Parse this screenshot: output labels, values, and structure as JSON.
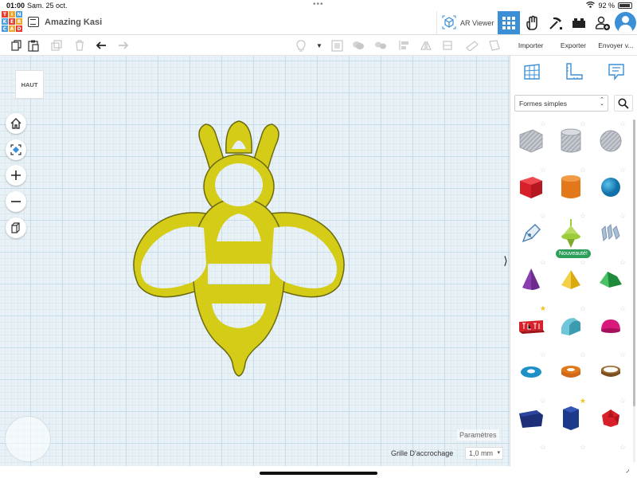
{
  "status_bar": {
    "time": "01:00",
    "date": "Sam. 25 oct.",
    "battery": "92 %"
  },
  "app": {
    "logo_letters": [
      "T",
      "I",
      "N",
      "K",
      "E",
      "R",
      "C",
      "A",
      "D"
    ],
    "design_title": "Amazing Kasi",
    "ar_viewer_label": "AR Viewer",
    "accent_color": "#3a8fd6"
  },
  "toolbar": {
    "icons": [
      "copy-icon",
      "paste-icon",
      "duplicate-icon",
      "delete-icon",
      "undo-icon",
      "redo-icon",
      "light-icon",
      "dropdown-icon",
      "hole-icon",
      "group-icon",
      "align-icon",
      "mirror-icon",
      "ruler-icon",
      "workplane-icon",
      "note-icon"
    ]
  },
  "panel_tabs": {
    "import": "Importer",
    "export": "Exporter",
    "send": "Envoyer v..."
  },
  "viewport": {
    "view_cube_label": "HAUT",
    "model_color": "#d4cc16",
    "params_label": "Paramètres",
    "snap_label": "Grille D'accrochage",
    "snap_value": "1,0 mm"
  },
  "library": {
    "category": "Formes simples",
    "new_badge": "Nouveauté!",
    "shapes": [
      {
        "name": "box-hole",
        "color": "#b8bcc4"
      },
      {
        "name": "cylinder-hole",
        "color": "#b8bcc4"
      },
      {
        "name": "sphere-hole",
        "color": "#b8bcc4"
      },
      {
        "name": "box",
        "color": "#d8202a"
      },
      {
        "name": "cylinder",
        "color": "#e2781a"
      },
      {
        "name": "sphere",
        "color": "#1e90c8"
      },
      {
        "name": "scribble",
        "color": "#4a7fb5"
      },
      {
        "name": "shape-generator",
        "color": "#9ccc3c"
      },
      {
        "name": "text-3d",
        "color": "#9ab0c8"
      },
      {
        "name": "cone",
        "color": "#8a3fb0"
      },
      {
        "name": "pyramid",
        "color": "#f0c419"
      },
      {
        "name": "roof",
        "color": "#2ea94b"
      },
      {
        "name": "text",
        "color": "#d8202a"
      },
      {
        "name": "round-roof",
        "color": "#5ab8c8"
      },
      {
        "name": "half-sphere",
        "color": "#d8187a"
      },
      {
        "name": "torus",
        "color": "#1e90c8"
      },
      {
        "name": "tube",
        "color": "#e2781a"
      },
      {
        "name": "ring",
        "color": "#9c6a30"
      },
      {
        "name": "wedge",
        "color": "#1c2f78"
      },
      {
        "name": "polygon",
        "color": "#1c3a8a"
      },
      {
        "name": "icosahedron",
        "color": "#d8202a"
      }
    ]
  }
}
